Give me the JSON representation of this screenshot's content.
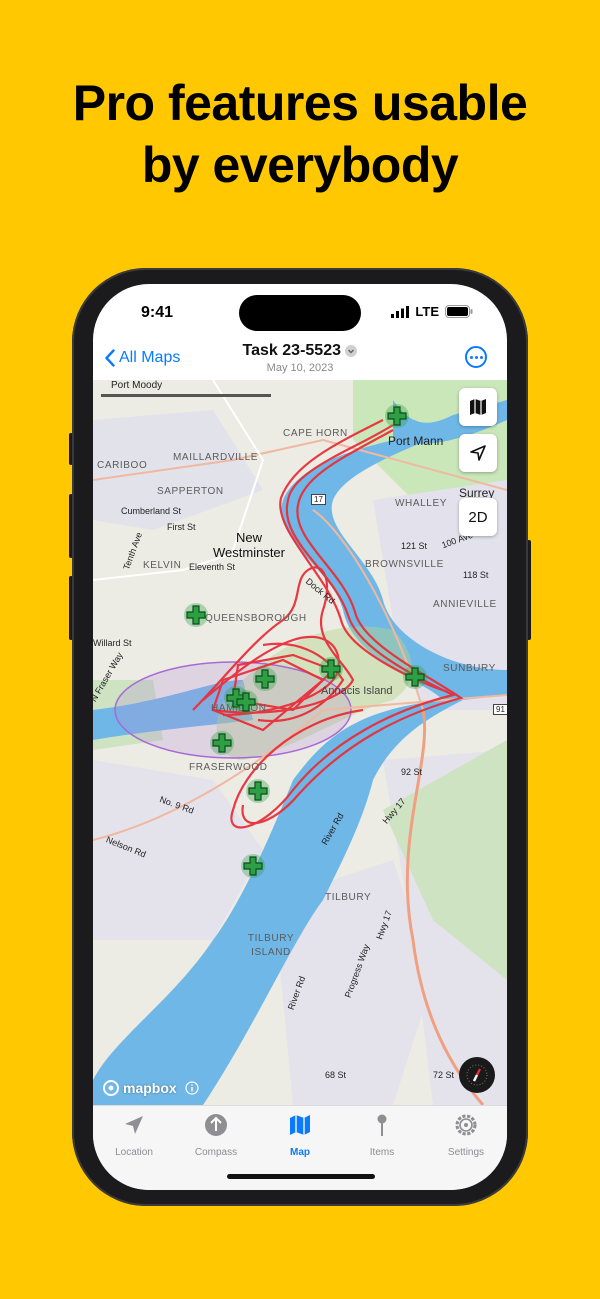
{
  "headline": {
    "line1": "Pro features usable",
    "line2": "by everybody"
  },
  "status_bar": {
    "time": "9:41",
    "network": "LTE"
  },
  "navbar": {
    "back_label": "All Maps",
    "title": "Task 23-5523",
    "subtitle": "May 10, 2023"
  },
  "map": {
    "attribution": "mapbox",
    "controls": {
      "mode_2d": "2D"
    },
    "labels": [
      {
        "id": "port-moody",
        "text": "Port Moody"
      },
      {
        "id": "cape-horn",
        "text": "CAPE HORN"
      },
      {
        "id": "port-mann",
        "text": "Port Mann"
      },
      {
        "id": "maillardville",
        "text": "MAILLARDVILLE"
      },
      {
        "id": "cariboo",
        "text": "CARIBOO"
      },
      {
        "id": "sapperton",
        "text": "SAPPERTON"
      },
      {
        "id": "whalley",
        "text": "WHALLEY"
      },
      {
        "id": "surrey",
        "text": "Surrey"
      },
      {
        "id": "cumberland",
        "text": "Cumberland St"
      },
      {
        "id": "first-st",
        "text": "First St"
      },
      {
        "id": "tenth-ave",
        "text": "Tenth Ave"
      },
      {
        "id": "new-westminster",
        "text": "New Westminster"
      },
      {
        "id": "kelvin",
        "text": "KELVIN"
      },
      {
        "id": "eleventh",
        "text": "Eleventh St"
      },
      {
        "id": "121st",
        "text": "121 St"
      },
      {
        "id": "100ave",
        "text": "100 Ave"
      },
      {
        "id": "brownsville",
        "text": "BROWNSVILLE"
      },
      {
        "id": "118st",
        "text": "118 St"
      },
      {
        "id": "dock-rd",
        "text": "Dock Rd"
      },
      {
        "id": "queensborough",
        "text": "QUEENSBOROUGH"
      },
      {
        "id": "annieville",
        "text": "ANNIEVILLE"
      },
      {
        "id": "willard",
        "text": "Willard St"
      },
      {
        "id": "sunbury",
        "text": "SUNBURY"
      },
      {
        "id": "fraser-way",
        "text": "N Fraser Way"
      },
      {
        "id": "annacis",
        "text": "Annacis Island"
      },
      {
        "id": "hamilton",
        "text": "HAMILTON"
      },
      {
        "id": "fraserwood",
        "text": "FRASERWOOD"
      },
      {
        "id": "92st",
        "text": "92 St"
      },
      {
        "id": "hwy17a",
        "text": "Hwy 17"
      },
      {
        "id": "no9rd",
        "text": "No. 9 Rd"
      },
      {
        "id": "river-rd",
        "text": "River Rd"
      },
      {
        "id": "nelson",
        "text": "Nelson Rd"
      },
      {
        "id": "tilbury",
        "text": "TILBURY"
      },
      {
        "id": "hwy17b",
        "text": "Hwy 17"
      },
      {
        "id": "tilbury-island",
        "text": "TILBURY ISLAND"
      },
      {
        "id": "progress",
        "text": "Progress Way"
      },
      {
        "id": "river-rd2",
        "text": "River Rd"
      },
      {
        "id": "68st",
        "text": "68 St"
      },
      {
        "id": "72st",
        "text": "72 St"
      },
      {
        "id": "hwy17c",
        "text": "17"
      },
      {
        "id": "hwy91",
        "text": "91"
      }
    ],
    "markers_count_note": "green cross markers"
  },
  "tabs": [
    {
      "id": "location",
      "label": "Location",
      "icon": "location-arrow-icon"
    },
    {
      "id": "compass",
      "label": "Compass",
      "icon": "compass-icon"
    },
    {
      "id": "map",
      "label": "Map",
      "icon": "map-icon",
      "active": true
    },
    {
      "id": "items",
      "label": "Items",
      "icon": "pin-icon"
    },
    {
      "id": "settings",
      "label": "Settings",
      "icon": "gear-icon"
    }
  ],
  "colors": {
    "background": "#FFC800",
    "accent": "#0A7AFF",
    "track": "#E8303A",
    "marker": "#2EA043",
    "water": "#6FB7E6"
  }
}
